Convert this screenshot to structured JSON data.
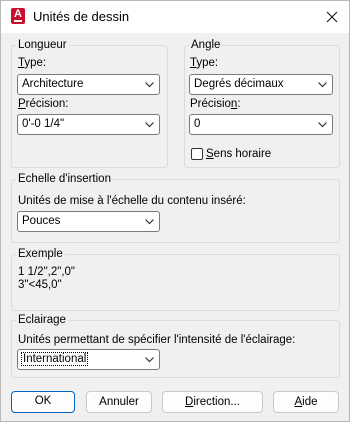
{
  "window": {
    "title": "Unités de dessin"
  },
  "longueur": {
    "title": "Longueur",
    "type_label_prefix": "T",
    "type_label_rest": "ype:",
    "type_value": "Architecture",
    "precision_label_prefix": "P",
    "precision_label_rest": "récision:",
    "precision_value": "0'-0 1/4\""
  },
  "angle": {
    "title": "Angle",
    "type_label_prefix": "T",
    "type_label_rest": "ype:",
    "type_value": "Degrés décimaux",
    "precision_label_prefix": "Précisio",
    "precision_label_underlined": "n",
    "precision_label_rest": ":",
    "precision_value": "0",
    "clockwise_prefix": "",
    "clockwise_underlined": "S",
    "clockwise_rest": "ens horaire",
    "clockwise_checked": false
  },
  "insertion": {
    "title": "Echelle d'insertion",
    "units_label": "Unités de mise à l'échelle du contenu inséré:",
    "units_value": "Pouces"
  },
  "exemple": {
    "title": "Exemple",
    "line1": "1 1/2\",2\",0\"",
    "line2": "3\"<45,0\""
  },
  "eclairage": {
    "title": "Eclairage",
    "units_label": "Unités permettant de spécifier l'intensité de l'éclairage:",
    "units_value": "International"
  },
  "buttons": {
    "ok": "OK",
    "annuler": "Annuler",
    "direction_prefix": "",
    "direction_underlined": "D",
    "direction_rest": "irection...",
    "aide_prefix": "",
    "aide_underlined": "A",
    "aide_rest": "ide"
  }
}
